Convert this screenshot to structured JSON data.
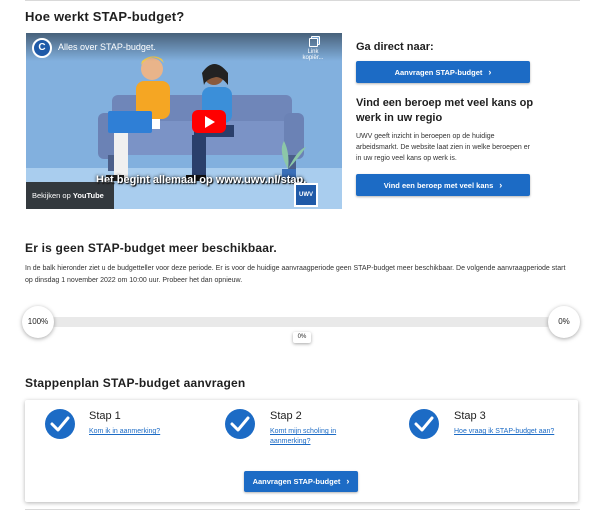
{
  "main_title": "Hoe werkt STAP-budget?",
  "video": {
    "title": "Alles over STAP-budget.",
    "logo_text": "C",
    "copy_label": "Link kopiër...",
    "caption": "Het begint allemaal op www.uwv.nl/stap.",
    "watch_on": "Bekijken op",
    "watch_brand": "YouTube",
    "brand_badge": "UWV"
  },
  "direct": {
    "heading": "Ga direct naar:",
    "apply_button": "Aanvragen STAP-budget"
  },
  "beroep": {
    "heading": "Vind een beroep met veel kans op werk in uw regio",
    "text": "UWV geeft inzicht in beroepen op de huidige arbeidsmarkt. De website laat zien in welke beroepen er in uw regio veel kans op werk is.",
    "button": "Vind een beroep met veel kans"
  },
  "budget": {
    "heading": "Er is geen STAP-budget meer beschikbaar.",
    "text": "In de balk hieronder ziet u de budgetteller voor deze periode. Er is voor de huidige aanvraagperiode geen STAP-budget meer beschikbaar. De volgende aanvraagperiode start op dinsdag 1 november 2022 om 10:00 uur. Probeer het dan opnieuw.",
    "left_label": "100%",
    "right_label": "0%",
    "current_label": "0%",
    "progress_fraction": 0
  },
  "steps": {
    "heading": "Stappenplan STAP-budget aanvragen",
    "items": [
      {
        "title": "Stap 1",
        "link": "Kom ik in aanmerking?"
      },
      {
        "title": "Stap 2",
        "link": "Komt mijn scholing in aanmerking?"
      },
      {
        "title": "Stap 3",
        "link": "Hoe vraag ik STAP-budget aan?"
      }
    ],
    "apply_button": "Aanvragen STAP-budget"
  },
  "colors": {
    "primary": "#1c6bc5",
    "youtube_red": "#ff0000"
  }
}
